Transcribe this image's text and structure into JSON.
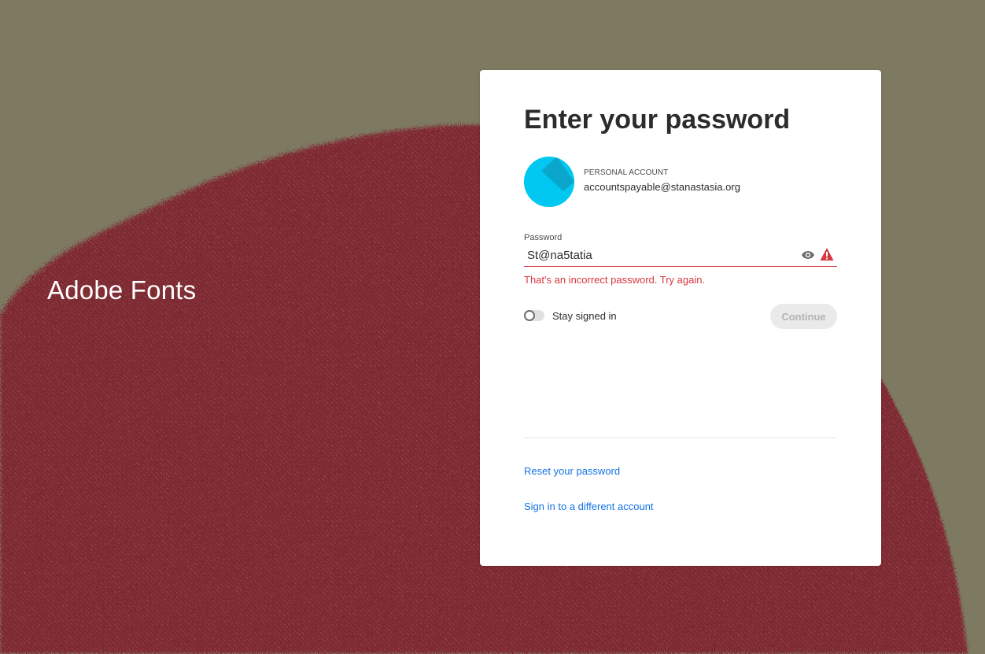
{
  "background": {
    "brand": "Adobe Fonts",
    "color": "#7e7a62",
    "art_color": "#8a2e33"
  },
  "card": {
    "title": "Enter your password",
    "account": {
      "type": "PERSONAL ACCOUNT",
      "email": "accountspayable@stanastasia.org",
      "avatar_color": "#00c8f0"
    },
    "password": {
      "label": "Password",
      "value": "St@na5tatia",
      "show_icon": "eye-icon",
      "status_icon": "alert-icon",
      "error": "That's an incorrect password. Try again."
    },
    "stay_signed_in": {
      "label": "Stay signed in",
      "checked": false
    },
    "continue_label": "Continue",
    "links": {
      "reset": "Reset your password",
      "different_account": "Sign in to a different account"
    }
  },
  "colors": {
    "error": "#d7373f",
    "link": "#1473e6",
    "disabled_button_bg": "#eaeaea"
  }
}
